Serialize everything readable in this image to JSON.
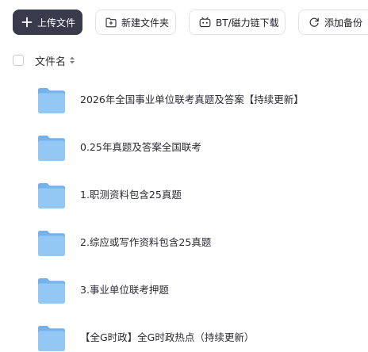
{
  "toolbar": {
    "upload_label": "上传文件",
    "new_folder_label": "新建文件夹",
    "bt_label": "BT/磁力链下载",
    "backup_label": "添加备份"
  },
  "list_header": {
    "name_column": "文件名"
  },
  "files": [
    {
      "name": "2026年全国事业单位联考真题及答案【持续更新】",
      "type": "folder"
    },
    {
      "name": "0.25年真题及答案全国联考",
      "type": "folder"
    },
    {
      "name": "1.职测资料包含25真题",
      "type": "folder"
    },
    {
      "name": "2.综应或写作资料包含25真题",
      "type": "folder"
    },
    {
      "name": "3.事业单位联考押题",
      "type": "folder"
    },
    {
      "name": "【全G时政】全G时政热点（持续更新）",
      "type": "folder"
    }
  ],
  "colors": {
    "primary_button": "#3a3a4d",
    "folder_blue": "#8fc4f3"
  }
}
